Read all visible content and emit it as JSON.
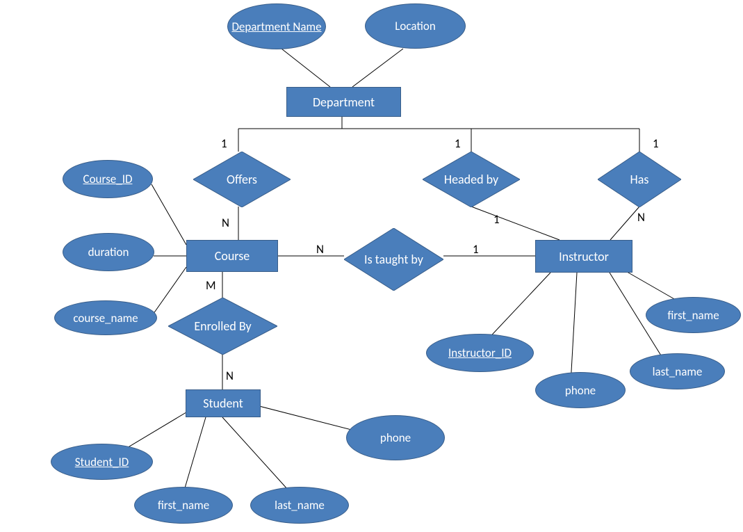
{
  "entities": {
    "department": "Department",
    "course": "Course",
    "student": "Student",
    "instructor": "Instructor"
  },
  "relationships": {
    "offers": "Offers",
    "headed_by": "Headed by",
    "has": "Has",
    "is_taught_by": "Is taught by",
    "enrolled_by": "Enrolled By"
  },
  "attributes": {
    "department_name": "Department Name",
    "location": "Location",
    "course_id": "Course_ID",
    "duration": "duration",
    "course_name": "course_name",
    "student_id": "Student_ID",
    "student_first_name": "first_name",
    "student_last_name": "last_name",
    "student_phone": "phone",
    "instructor_id": "Instructor_ID",
    "instructor_first_name": "first_name",
    "instructor_last_name": "last_name",
    "instructor_phone": "phone"
  },
  "cardinalities": {
    "offers_dept": "1",
    "offers_course": "N",
    "headed_dept": "1",
    "headed_instr": "1",
    "has_dept": "1",
    "has_instr": "N",
    "taught_course": "N",
    "taught_instr": "1",
    "enrolled_course": "M",
    "enrolled_student": "N"
  },
  "chart_data": {
    "type": "er-diagram",
    "entities": [
      {
        "name": "Department",
        "attributes": [
          {
            "name": "Department Name",
            "key": true
          },
          {
            "name": "Location"
          }
        ]
      },
      {
        "name": "Course",
        "attributes": [
          {
            "name": "Course_ID",
            "key": true
          },
          {
            "name": "duration"
          },
          {
            "name": "course_name"
          }
        ]
      },
      {
        "name": "Student",
        "attributes": [
          {
            "name": "Student_ID",
            "key": true
          },
          {
            "name": "first_name"
          },
          {
            "name": "last_name"
          },
          {
            "name": "phone"
          }
        ]
      },
      {
        "name": "Instructor",
        "attributes": [
          {
            "name": "Instructor_ID",
            "key": true
          },
          {
            "name": "first_name"
          },
          {
            "name": "last_name"
          },
          {
            "name": "phone"
          }
        ]
      }
    ],
    "relationships": [
      {
        "name": "Offers",
        "between": [
          "Department",
          "Course"
        ],
        "cardinality": [
          "1",
          "N"
        ]
      },
      {
        "name": "Headed by",
        "between": [
          "Department",
          "Instructor"
        ],
        "cardinality": [
          "1",
          "1"
        ]
      },
      {
        "name": "Has",
        "between": [
          "Department",
          "Instructor"
        ],
        "cardinality": [
          "1",
          "N"
        ]
      },
      {
        "name": "Is taught by",
        "between": [
          "Course",
          "Instructor"
        ],
        "cardinality": [
          "N",
          "1"
        ]
      },
      {
        "name": "Enrolled By",
        "between": [
          "Course",
          "Student"
        ],
        "cardinality": [
          "M",
          "N"
        ]
      }
    ]
  }
}
